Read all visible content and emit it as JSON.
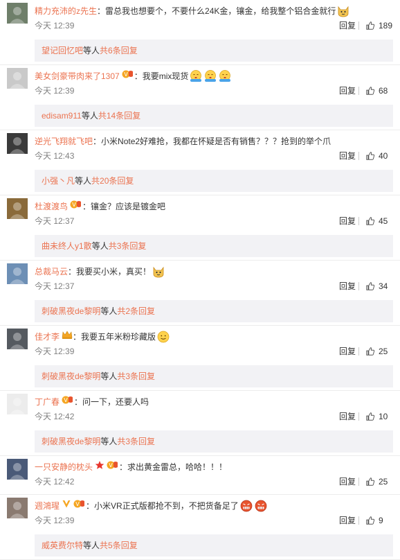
{
  "reply_label": "回复",
  "others_label": "等人",
  "comments": [
    {
      "user": "精力充沛的z先生",
      "text": "雷总我也想要个，不要什么24K金，镶金，给我整个铝合金就行",
      "time": "今天 12:39",
      "likes": "189",
      "emojis": [
        "doge-emoji"
      ],
      "badges": [],
      "reply_user": "望记回忆吧",
      "reply_count": "共6条回复"
    },
    {
      "user": "美女剑豪带肉来了1307",
      "text": "我要mix现货",
      "time": "今天 12:39",
      "likes": "68",
      "emojis": [
        "shy-emoji",
        "shy-emoji",
        "shy-emoji"
      ],
      "badges": [
        "vip-badge"
      ],
      "reply_user": "edisam911",
      "reply_count": "共14条回复"
    },
    {
      "user": "逆光飞翔就飞吧",
      "text": "小米Note2好难抢，我都在怀疑是否有销售？？？抢到的举个爪",
      "time": "今天 12:43",
      "likes": "40",
      "emojis": [],
      "badges": [],
      "reply_user": "小强丶凡",
      "reply_count": "共20条回复"
    },
    {
      "user": "杜渡渡鸟",
      "text": "镶金？应该是镀金吧",
      "time": "今天 12:37",
      "likes": "45",
      "emojis": [],
      "badges": [
        "vip-badge"
      ],
      "reply_user": "曲未终人y1散",
      "reply_count": "共3条回复"
    },
    {
      "user": "总裁马云",
      "text": "我要买小米，真买！",
      "time": "今天 12:37",
      "likes": "34",
      "emojis": [
        "doge-emoji"
      ],
      "badges": [],
      "reply_user": "刺破黑夜de黎明",
      "reply_count": "共2条回复"
    },
    {
      "user": "佳才李",
      "text": "我要五年米粉珍藏版",
      "time": "今天 12:39",
      "likes": "25",
      "emojis": [
        "smile-emoji"
      ],
      "badges": [
        "crown-badge"
      ],
      "reply_user": "刺破黑夜de黎明",
      "reply_count": "共3条回复"
    },
    {
      "user": "丁广春",
      "text": "问一下，还要人吗",
      "time": "今天 12:42",
      "likes": "10",
      "emojis": [],
      "badges": [
        "vip-badge"
      ],
      "reply_user": "刺破黑夜de黎明",
      "reply_count": "共3条回复"
    },
    {
      "user": "一只安静的枕头",
      "text": "求出黄金雷总，哈哈！！！",
      "time": "今天 12:42",
      "likes": "25",
      "emojis": [],
      "badges": [
        "star-badge",
        "vip-badge"
      ],
      "reply_user": "",
      "reply_count": ""
    },
    {
      "user": "週鴻瑆",
      "text": "小米VR正式版都抢不到，不把货备足了",
      "time": "今天 12:39",
      "likes": "9",
      "emojis": [
        "angry-emoji",
        "angry-emoji"
      ],
      "badges": [
        "v-badge",
        "vip-badge"
      ],
      "reply_user": "威英费尔特",
      "reply_count": "共5条回复"
    }
  ],
  "colors": {
    "link": "#eb7350",
    "reply_bg": "#f2f2f5",
    "time": "#808080"
  }
}
